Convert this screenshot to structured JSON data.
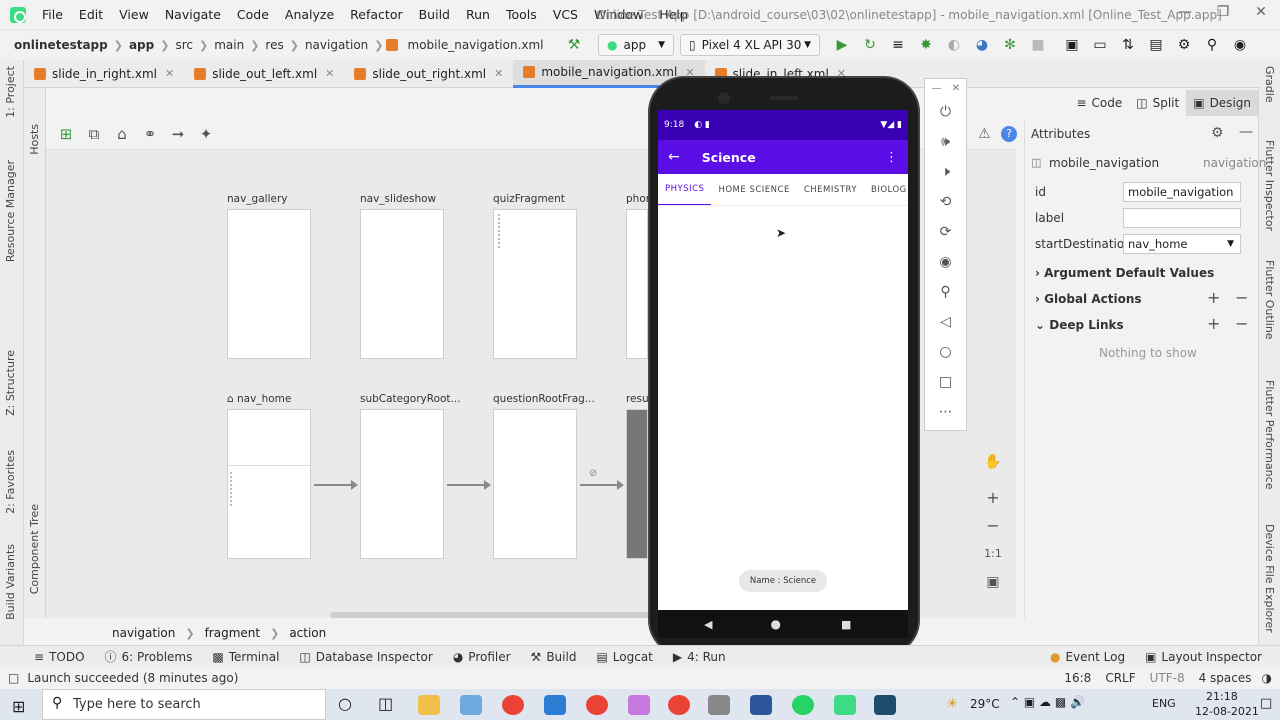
{
  "menubar": {
    "items": [
      "File",
      "Edit",
      "View",
      "Navigate",
      "Code",
      "Analyze",
      "Refactor",
      "Build",
      "Run",
      "Tools",
      "VCS",
      "Window",
      "Help"
    ],
    "title": "Online Test App [D:\\android_course\\03\\02\\onlinetestapp] - mobile_navigation.xml [Online_Test_App.app]"
  },
  "navbar": {
    "crumbs": [
      "onlinetestapp",
      "app",
      "src",
      "main",
      "res",
      "navigation",
      "mobile_navigation.xml"
    ],
    "run_config": "app",
    "device": "Pixel 4 XL API 30"
  },
  "tabs": [
    "slide_in_right.xml",
    "slide_out_left.xml",
    "slide_out_right.xml",
    "mobile_navigation.xml",
    "slide_in_left.xml"
  ],
  "left_strip": {
    "project": "1: Project",
    "resource_manager": "Resource Manager",
    "structure": "Z: Structure",
    "favorites": "2: Favorites",
    "build_variants": "Build Variants",
    "hosts": "Hosts",
    "component_tree": "Component Tree"
  },
  "right_strip": {
    "gradle": "Gradle",
    "flutter_inspector": "Flutter Inspector",
    "flutter_outline": "Flutter Outline",
    "flutter_performance": "Flutter Performance",
    "device_file_explorer": "Device File Explorer"
  },
  "destinations": {
    "row1": [
      "nav_gallery",
      "nav_slideshow",
      "quizFragment",
      "phon"
    ],
    "row2": [
      "nav_home",
      "subCategoryRoot...",
      "questionRootFrag...",
      "resul"
    ]
  },
  "phone": {
    "time": "9:18",
    "title": "Science",
    "tabs": [
      "PHYSICS",
      "HOME SCIENCE",
      "CHEMISTRY",
      "BIOLOG"
    ],
    "toast": "Name : Science"
  },
  "modes": [
    "Code",
    "Split",
    "Design"
  ],
  "attributes": {
    "header": "Attributes",
    "component": "mobile_navigation",
    "component_type": "navigation",
    "id_label": "id",
    "id_value": "mobile_navigation",
    "label_label": "label",
    "label_value": "",
    "start_label": "startDestination",
    "start_value": "nav_home",
    "sections": [
      "Argument Default Values",
      "Global Actions",
      "Deep Links"
    ],
    "empty": "Nothing to show"
  },
  "zoom": {
    "fit": "1:1"
  },
  "path": [
    "navigation",
    "fragment",
    "action"
  ],
  "toolwindows": [
    "TODO",
    "6: Problems",
    "Terminal",
    "Database Inspector",
    "Profiler",
    "Build",
    "Logcat",
    "4: Run",
    "Event Log",
    "Layout Inspector"
  ],
  "status": {
    "message": "Launch succeeded (8 minutes ago)",
    "position": "16:8",
    "line_sep": "CRLF",
    "encoding": "UTF-8",
    "indent": "4 spaces"
  },
  "taskbar": {
    "search": "Type here to search",
    "weather": "29°C",
    "lang": "ENG",
    "time": "21:18",
    "date": "12-08-2021"
  }
}
